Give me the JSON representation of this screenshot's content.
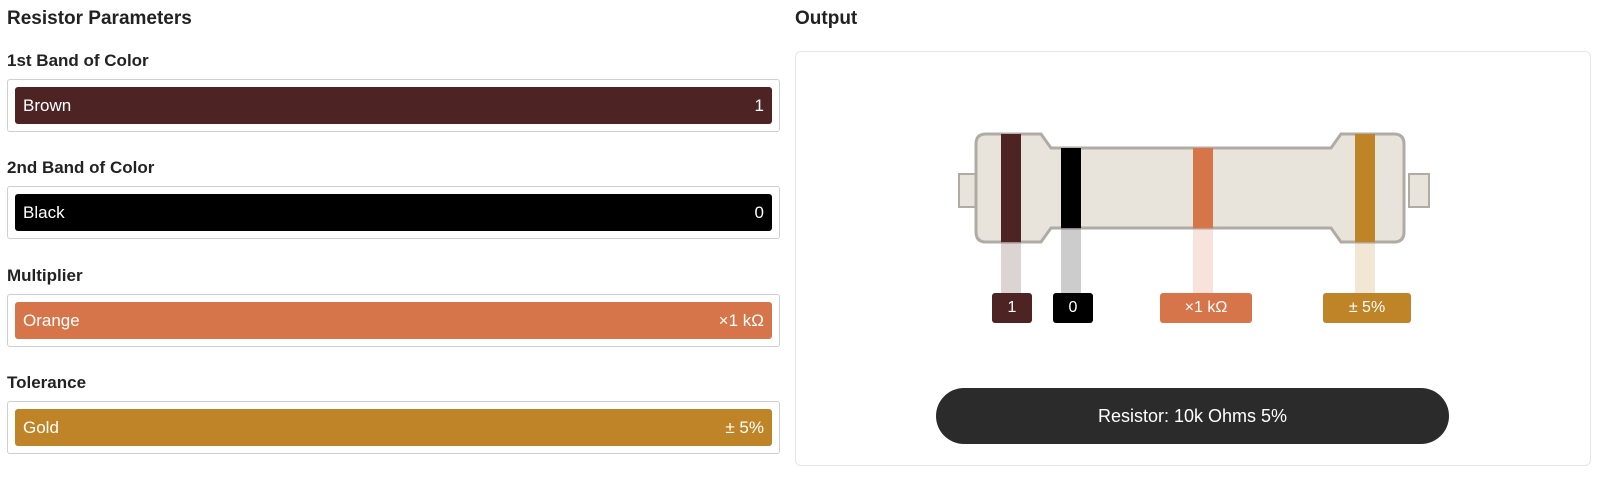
{
  "parameters": {
    "title": "Resistor Parameters",
    "bands": [
      {
        "label": "1st Band of Color",
        "color_name": "Brown",
        "value": "1",
        "color": "#4e2324"
      },
      {
        "label": "2nd Band of Color",
        "color_name": "Black",
        "value": "0",
        "color": "#000000"
      },
      {
        "label": "Multiplier",
        "color_name": "Orange",
        "value": "×1 kΩ",
        "color": "#d6754a"
      },
      {
        "label": "Tolerance",
        "color_name": "Gold",
        "value": "± 5%",
        "color": "#bf8427"
      }
    ]
  },
  "output": {
    "title": "Output",
    "resistor_body_color": "#e8e3db",
    "resistor_outline_color": "#b0aca5",
    "band_labels": [
      "1",
      "0",
      "×1 kΩ",
      "± 5%"
    ],
    "result": "Resistor: 10k Ohms 5%",
    "result_background": "#2b2b2b"
  }
}
